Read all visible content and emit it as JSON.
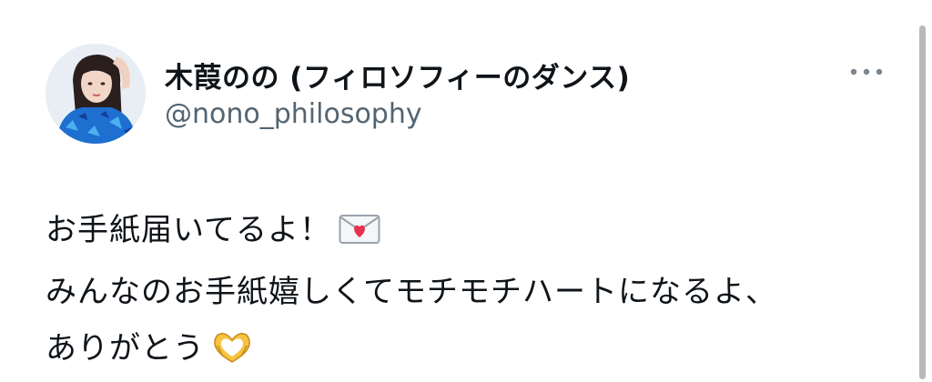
{
  "author": {
    "display_name": "木葭のの (フィロソフィーのダンス)",
    "handle": "@nono_philosophy"
  },
  "tweet": {
    "lines": [
      "お手紙届いてるよ！",
      "みんなのお手紙嬉しくてモチモチハートになるよ、",
      "ありがとう"
    ],
    "emojis": {
      "line1": "love-letter-icon",
      "line3": "heart-hands-icon"
    }
  },
  "icons": {
    "more": "more-options-icon"
  },
  "colors": {
    "text": "#0f1419",
    "secondary_text": "#536471",
    "heart": "#e8304f",
    "scrollbar": "#b9b9b9"
  }
}
